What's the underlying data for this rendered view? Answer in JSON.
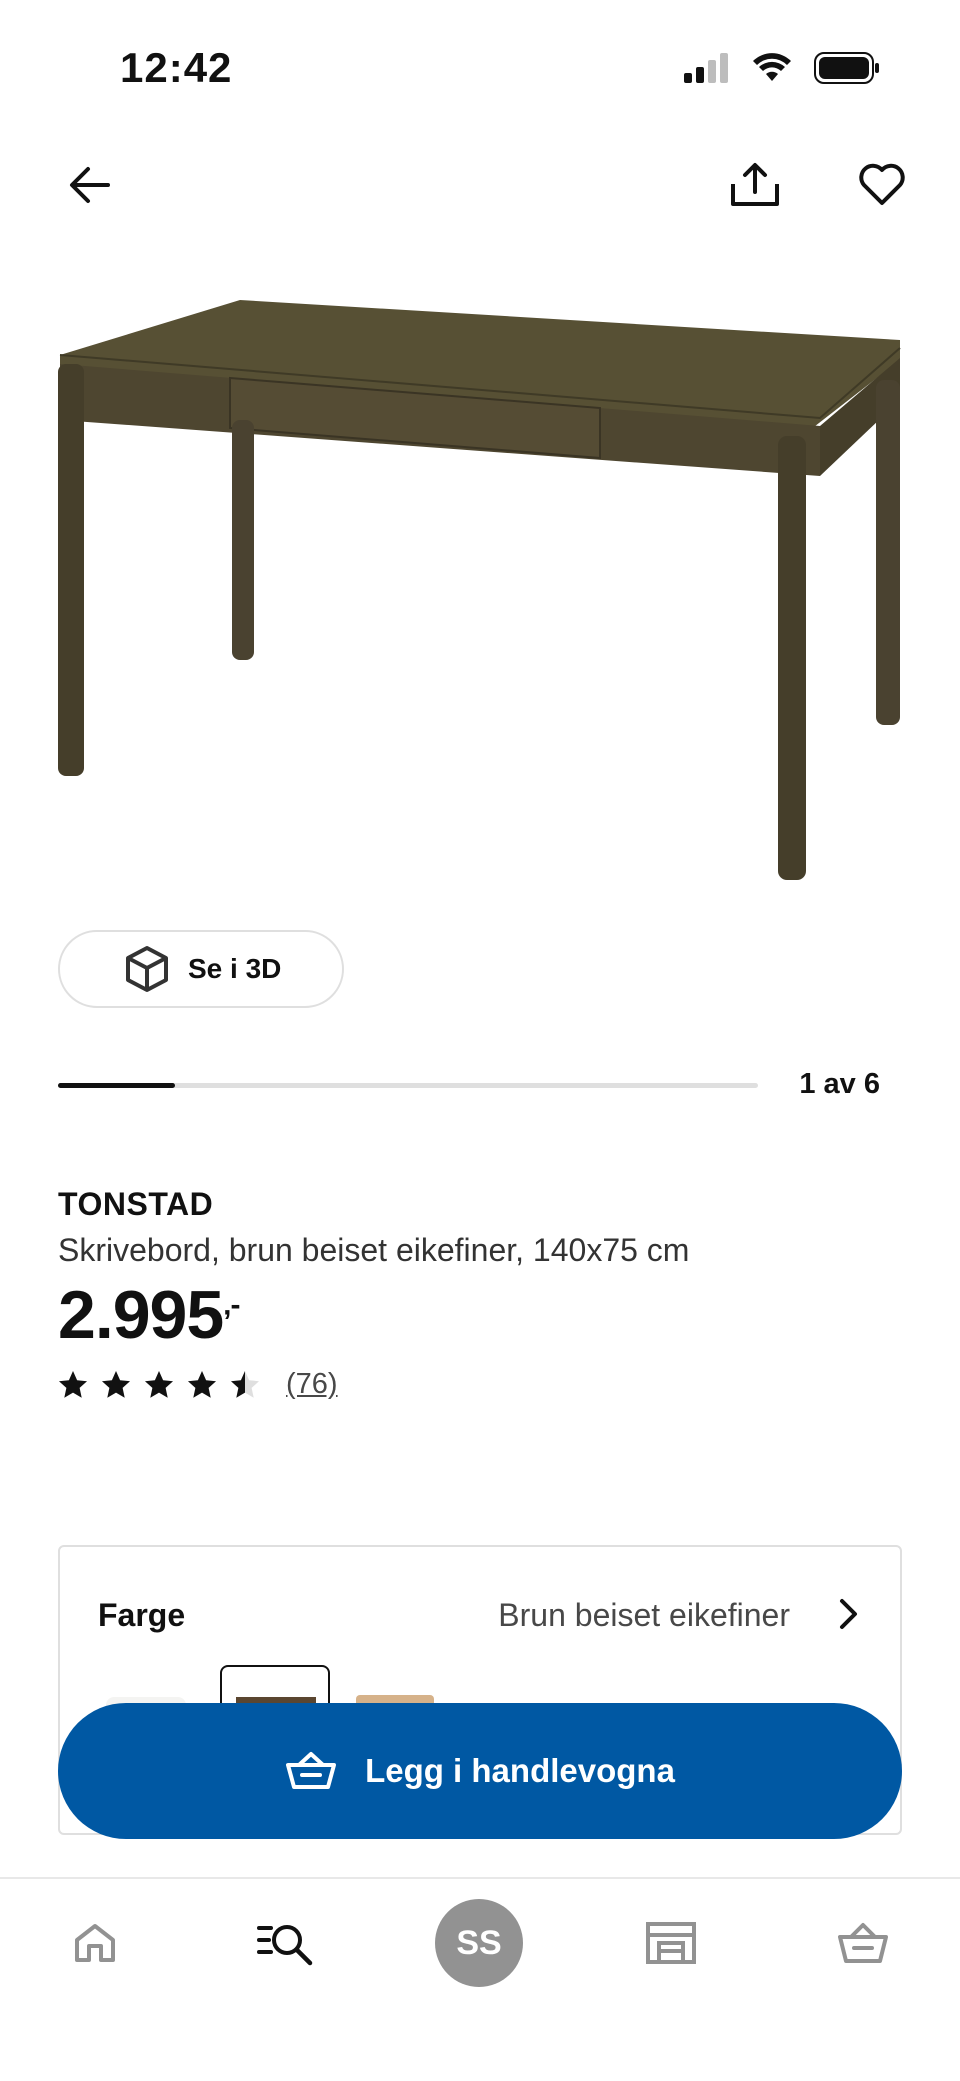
{
  "status_bar": {
    "time": "12:42"
  },
  "header": {
    "back_icon": "arrow-left-icon",
    "share_icon": "share-icon",
    "favorite_icon": "heart-icon"
  },
  "gallery": {
    "view_3d_label": "Se i 3D",
    "counter": "1 av 6",
    "current": 1,
    "total": 6
  },
  "product": {
    "name": "TONSTAD",
    "description": "Skrivebord, brun beiset eikefiner, 140x75 cm",
    "price": "2.995",
    "price_suffix": ",-",
    "rating": 4.5,
    "rating_max": 5,
    "review_count": "(76)"
  },
  "color_selector": {
    "label": "Farge",
    "value": "Brun beiset eikefiner"
  },
  "cart": {
    "button_label": "Legg i handlevogna"
  },
  "tab_bar": {
    "avatar_initials": "SS"
  },
  "colors": {
    "brand_blue": "#0058a3",
    "wood_dark": "#4a4230",
    "avatar_gray": "#929292"
  }
}
